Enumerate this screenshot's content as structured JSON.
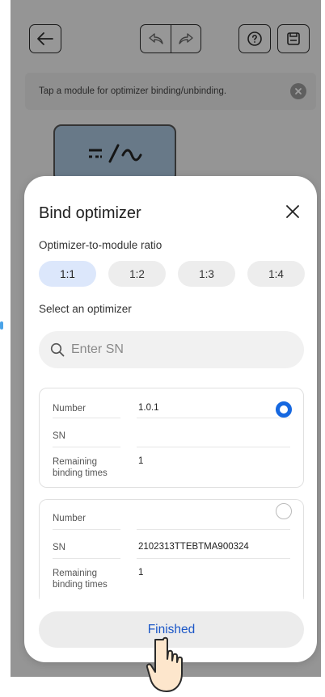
{
  "toolbar": {
    "back_icon": "arrow-left-icon",
    "undo_icon": "undo-icon",
    "redo_icon": "redo-icon",
    "help_icon": "help-icon",
    "save_icon": "save-icon"
  },
  "hint": {
    "text": "Tap a module for optimizer binding/unbinding.",
    "close_icon": "close-circle-icon"
  },
  "module": {
    "symbol": "=/~"
  },
  "sheet": {
    "title": "Bind optimizer",
    "close_icon": "close-icon",
    "ratio_label": "Optimizer-to-module ratio",
    "ratios": [
      {
        "label": "1:1",
        "selected": true
      },
      {
        "label": "1:2",
        "selected": false
      },
      {
        "label": "1:3",
        "selected": false
      },
      {
        "label": "1:4",
        "selected": false
      }
    ],
    "select_label": "Select an optimizer",
    "search_placeholder": "Enter SN",
    "optimizers": [
      {
        "number_label": "Number",
        "number": "1.0.1",
        "sn_label": "SN",
        "sn": "",
        "remaining_label": "Remaining binding times",
        "remaining": "1",
        "selected": true
      },
      {
        "number_label": "Number",
        "number": "",
        "sn_label": "SN",
        "sn": "2102313TTEBTMA900324",
        "remaining_label": "Remaining binding times",
        "remaining": "1",
        "selected": false
      }
    ],
    "finish_label": "Finished"
  },
  "colors": {
    "accent": "#1668e0",
    "finish_text": "#1a56c7",
    "selected_pill": "#dce7fb"
  }
}
